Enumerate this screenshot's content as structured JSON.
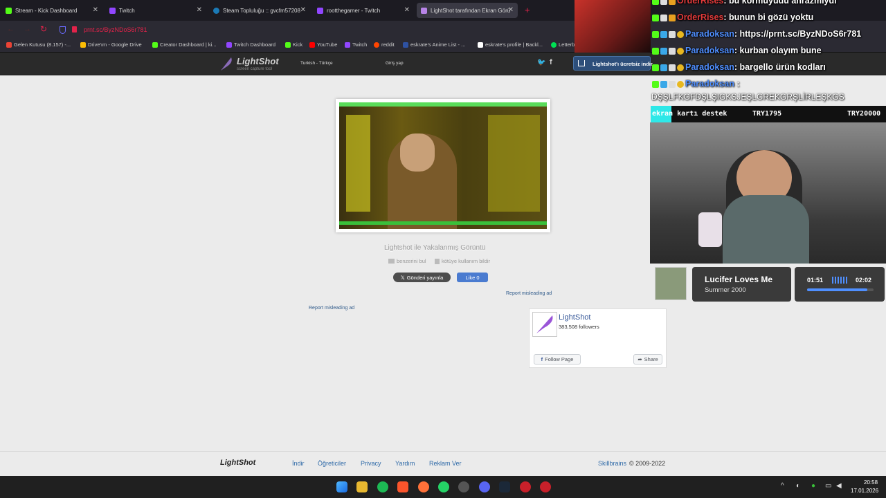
{
  "tabs": [
    {
      "label": "Stream - Kick Dashboard",
      "icon": "kick-icon",
      "color": "#53fc18"
    },
    {
      "label": "Twitch",
      "icon": "twitch-icon",
      "color": "#9146ff"
    },
    {
      "label": "Steam Topluluğu :: gvcfm57208",
      "icon": "steam-icon",
      "color": "#1b7ab6"
    },
    {
      "label": "rootthegamer - Twitch",
      "icon": "twitch-icon",
      "color": "#9146ff"
    },
    {
      "label": "LightShot tarafından Ekran Görü",
      "icon": "lightshot-icon",
      "color": "#b884e8"
    }
  ],
  "url": "prnt.sc/ByzNDoS6r781",
  "bookmarks": [
    {
      "label": "Gelen Kutusu (8.157) -...",
      "color": "#ea4335"
    },
    {
      "label": "Drive'ım - Google Drive",
      "color": "#fbbc04"
    },
    {
      "label": "Creator Dashboard | ki...",
      "color": "#53fc18"
    },
    {
      "label": "Twitch Dashboard",
      "color": "#9146ff"
    },
    {
      "label": "Kick",
      "color": "#53fc18"
    },
    {
      "label": "YouTube",
      "color": "#ff0000"
    },
    {
      "label": "Twitch",
      "color": "#9146ff"
    },
    {
      "label": "reddit",
      "color": "#ff4500"
    },
    {
      "label": "eskrate's Anime List - ...",
      "color": "#2e51a2"
    },
    {
      "label": "eskrate's profile | Backl...",
      "color": "#ffffff"
    },
    {
      "label": "Letterboxd • Social fil...",
      "color": "#00e054"
    }
  ],
  "lightshot": {
    "logo": "LightShot",
    "tagline": "screen capture tool",
    "lang": "Turkish - Türkçe",
    "login": "Giriş yap",
    "download_banner": "Lightshot'ı ücretsiz indir",
    "caption": "Lightshot ile Yakalanmış Görüntü",
    "find_similar": "benzerini bul",
    "report_abuse": "kötüye kullanım bildir",
    "tweet": "Gönderi yayınla",
    "like": "Like 0",
    "report_ad_1": "Report misleading ad",
    "report_ad_2": "Report misleading ad",
    "fb_name": "LightShot",
    "fb_followers": "383,508 followers",
    "fb_follow": "Follow Page",
    "fb_share": "Share"
  },
  "footer": {
    "logo": "LightShot",
    "links": [
      "İndir",
      "Öğreticiler",
      "Privacy",
      "Yardım",
      "Reklam Ver"
    ],
    "brand": "Skillbrains",
    "copyright": "© 2009-2022"
  },
  "chat": [
    {
      "user": "OrderRises",
      "msg": ": bu kormuyudu ahrazmiydi",
      "color": "#e03a3a"
    },
    {
      "user": "OrderRises",
      "msg": ": bunun bi gözü yoktu",
      "color": "#e03a3a"
    },
    {
      "user": "Paradoksan",
      "msg": ": https://prnt.sc/ByzNDoS6r781",
      "color": "#4f8fff"
    },
    {
      "user": "Paradoksan",
      "msg": ": kurban olayım bune",
      "color": "#4f8fff"
    },
    {
      "user": "Paradoksan",
      "msg": ": bargello ürün kodları",
      "color": "#4f8fff"
    },
    {
      "user": "Paradoksan",
      "msg": " :",
      "color": "#4f8fff"
    }
  ],
  "chat_wrap": "DŞŞLFKGFDŞLŞIGKSJEŞLGREKGRŞLİRLEŞKGS",
  "ticker": {
    "label": "ekran kartı destek",
    "current": "TRY1795",
    "goal": "TRY20000"
  },
  "music": {
    "title": "Lucifer Loves Me",
    "artist": "Summer 2000",
    "elapsed": "01:51",
    "total": "02:02",
    "progress": 0.91
  },
  "clock": {
    "time": "20:58",
    "date": "17.01.2026"
  }
}
